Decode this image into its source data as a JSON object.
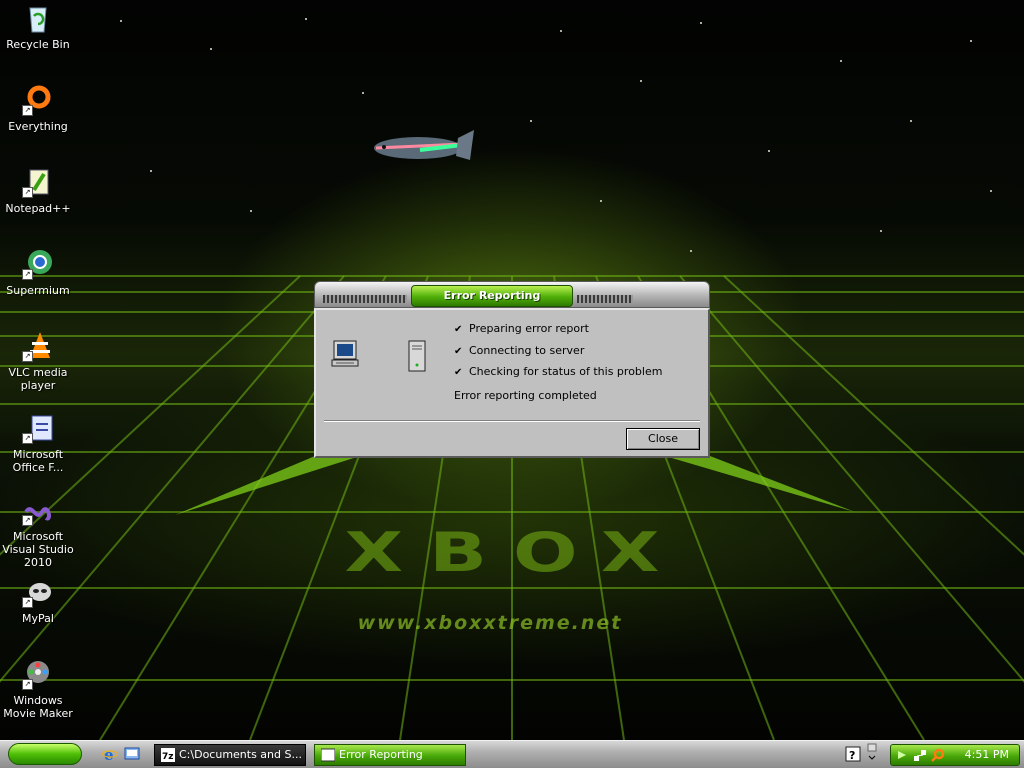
{
  "desktop": {
    "icons": [
      {
        "label": "Recycle Bin"
      },
      {
        "label": "Everything"
      },
      {
        "label": "Notepad++"
      },
      {
        "label": "Supermium"
      },
      {
        "label": "VLC media player"
      },
      {
        "label": "Microsoft Office F..."
      },
      {
        "label": "Microsoft Visual Studio 2010"
      },
      {
        "label": "MyPal"
      },
      {
        "label": "Windows Movie Maker"
      }
    ],
    "wallpaper": {
      "logo_text": "XBOX",
      "url_text": "www.xboxxtreme.net"
    }
  },
  "dialog": {
    "title": "Error Reporting",
    "steps": [
      {
        "label": "Preparing error report"
      },
      {
        "label": "Connecting to server"
      },
      {
        "label": "Checking for status of this problem"
      }
    ],
    "status": "Error reporting completed",
    "close_label": "Close"
  },
  "taskbar": {
    "tasks": [
      {
        "label": "C:\\Documents and S..."
      },
      {
        "label": "Error Reporting"
      }
    ],
    "clock": "4:51 PM"
  },
  "colors": {
    "accent_green": "#4fae08",
    "dialog_face": "#c0c0c0"
  }
}
